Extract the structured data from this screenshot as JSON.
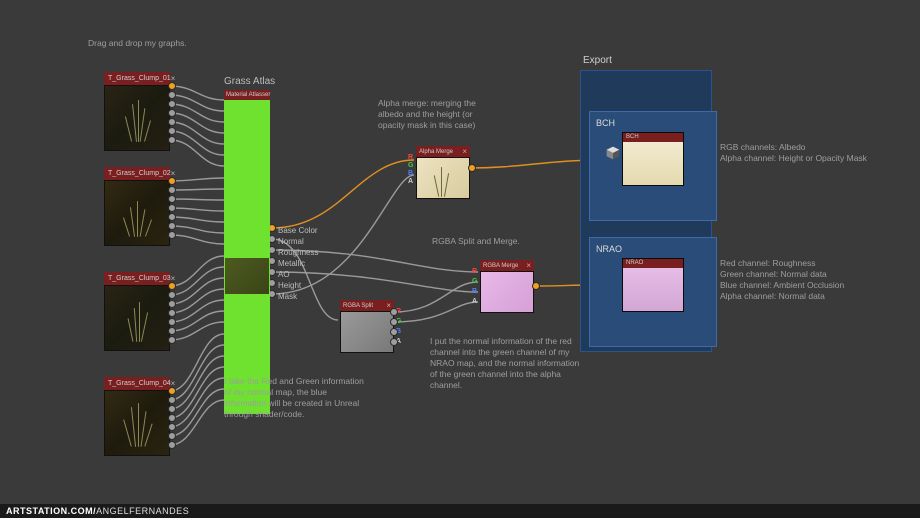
{
  "footer": {
    "site": "ARTSTATION.COM/",
    "user": "ANGELFERNANDES"
  },
  "captions": {
    "drag": "Drag and drop my graphs.",
    "atlas_title": "Grass Atlas",
    "alpha_merge": "Alpha merge: merging the albedo and the height (or opacity mask in this case)",
    "rgba_split": "RGBA Split and Merge.",
    "normal_explain": "I take the Red and Green information of my normal map, the blue information will be created in Unreal through shader/code.",
    "nrao_explain": "I put the normal information of the red channel into the green channel of my NRAO map, and the normal information of the green channel into the alpha channel.",
    "bch_desc": "RGB channels: Albedo\nAlpha channel: Height or Opacity Mask",
    "nrao_desc": "Red channel: Roughness\nGreen channel: Normal data\nBlue channel: Ambient Occlusion\nAlpha channel: Normal data"
  },
  "export": {
    "title": "Export",
    "bch_label": "BCH",
    "nrao_label": "NRAO",
    "bch_thumb": "BCH",
    "nrao_thumb": "NRAO"
  },
  "inputs": [
    {
      "name": "T_Grass_Clump_01"
    },
    {
      "name": "T_Grass_Clump_02"
    },
    {
      "name": "T_Grass_Clump_03"
    },
    {
      "name": "T_Grass_Clump_04"
    }
  ],
  "atlas": {
    "header": "Material Atlasser",
    "outputs": [
      "Base Color",
      "Normal",
      "Roughness",
      "Metallic",
      "AO",
      "Height",
      "Mask"
    ]
  },
  "nodes": {
    "alpha_merge": "Alpha Merge",
    "rgba_split": "RGBA Split",
    "rgba_merge": "RGBA Merge"
  },
  "ports": {
    "r": "R",
    "g": "G",
    "b": "B",
    "a": "A"
  }
}
